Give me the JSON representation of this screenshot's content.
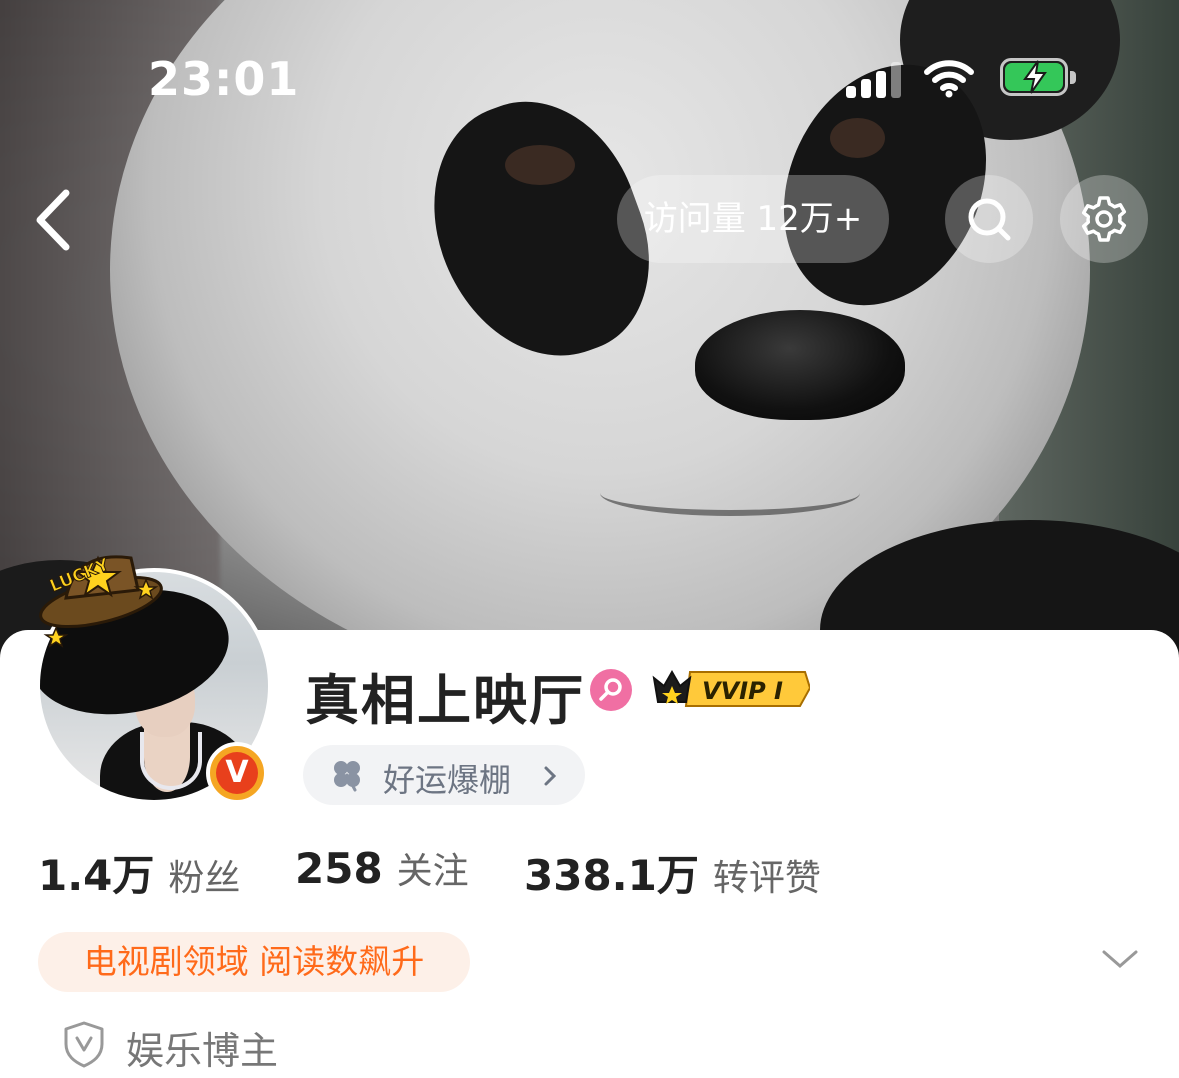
{
  "status_bar": {
    "time": "23:01"
  },
  "header": {
    "visits_label": "访问量 12万+",
    "icons": [
      "back-chevron-icon",
      "search-icon",
      "gear-icon"
    ]
  },
  "profile": {
    "name": "真相上映厅",
    "vip_badge": "VVIP I",
    "verified_badge": "V",
    "avatar_sticker": "LUCKY",
    "luck_pill": "好运爆棚",
    "stats": [
      {
        "value": "1.4万",
        "label": "粉丝"
      },
      {
        "value": "258",
        "label": "关注"
      },
      {
        "value": "338.1万",
        "label": "转评赞"
      }
    ],
    "tag": "电视剧领域 阅读数飙升",
    "category": "娱乐博主"
  },
  "colors": {
    "accent_orange": "#ff6a1a",
    "battery_green": "#34c759",
    "gender_pink": "#f06fa3",
    "verified_red": "#e8401c",
    "verified_gold": "#f5a623"
  }
}
